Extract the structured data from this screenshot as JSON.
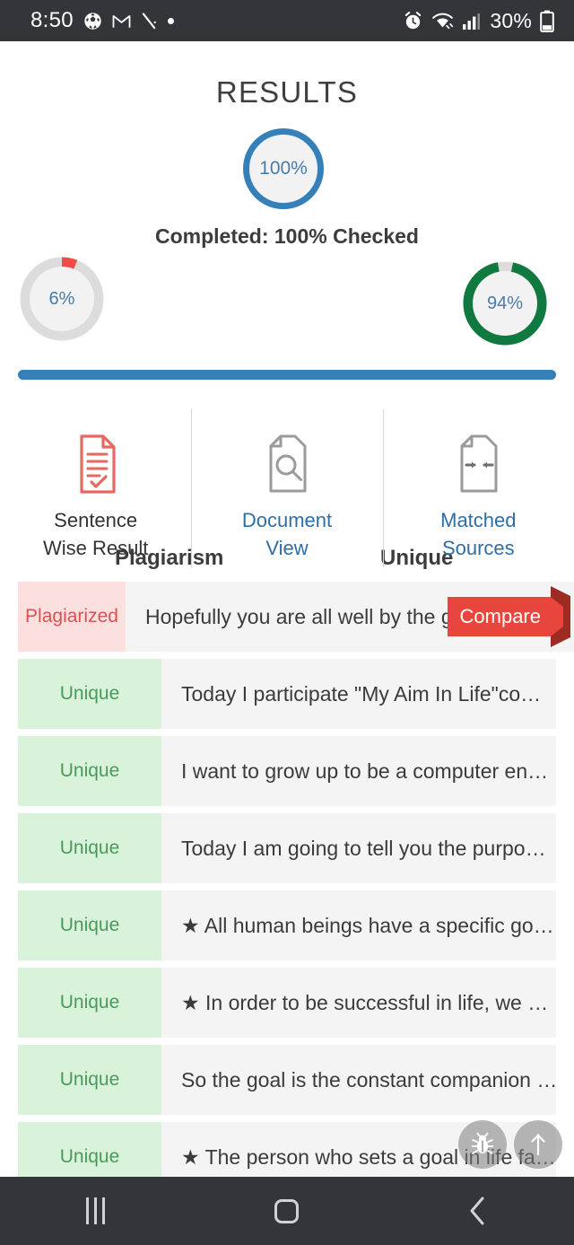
{
  "status_bar": {
    "time": "8:50",
    "left_icons": [
      "soccer-ball-icon",
      "gmail-icon",
      "slash-icon",
      "dot-icon"
    ],
    "right_icons": [
      "alarm-icon",
      "wifi-icon",
      "signal-icon",
      "battery-icon"
    ],
    "battery_percent": "30%"
  },
  "header": {
    "title": "RESULTS",
    "overall_percent": "100%",
    "completed_text": "Completed: 100% Checked"
  },
  "meters": {
    "plagiarism": {
      "value": "6%",
      "label": "Plagiarism",
      "percent": 6,
      "color": "#ef4b48",
      "track": "#dcdcdc"
    },
    "unique": {
      "value": "94%",
      "label": "Unique",
      "percent": 94,
      "color": "#10793f",
      "track": "#dcdcdc"
    }
  },
  "progress_bar": {
    "percent": 100,
    "color": "#3580b8"
  },
  "tabs": [
    {
      "label_line1": "Sentence",
      "label_line2": "Wise Result",
      "icon": "document-check-icon",
      "active": true
    },
    {
      "label_line1": "Document",
      "label_line2": "View",
      "icon": "document-search-icon",
      "active": false
    },
    {
      "label_line1": "Matched",
      "label_line2": "Sources",
      "icon": "document-arrows-icon",
      "active": false
    }
  ],
  "compare_button": {
    "label": "Compare",
    "color": "#e8453c"
  },
  "sentences": [
    {
      "status": "Plagiarized",
      "text": "Hopefully you are all well by the g…",
      "type": "plagiarized"
    },
    {
      "status": "Unique",
      "text": "Today I participate \"My Aim In Life\"co…",
      "type": "unique"
    },
    {
      "status": "Unique",
      "text": "I want to grow up to be a computer en…",
      "type": "unique"
    },
    {
      "status": "Unique",
      "text": "Today I am going to tell you the purpo…",
      "type": "unique"
    },
    {
      "status": "Unique",
      "text": "★ All human beings have a specific go…",
      "type": "unique"
    },
    {
      "status": "Unique",
      "text": "★ In order to be successful in life, we …",
      "type": "unique"
    },
    {
      "status": "Unique",
      "text": "So the goal is the constant companion …",
      "type": "unique"
    },
    {
      "status": "Unique",
      "text": "★ The person who sets a goal in life fa…",
      "type": "unique"
    }
  ],
  "fabs": [
    {
      "icon": "bug-icon"
    },
    {
      "icon": "arrow-up-icon"
    }
  ],
  "nav_bar": {
    "recents": "recents-icon",
    "home": "home-icon",
    "back": "back-icon"
  }
}
